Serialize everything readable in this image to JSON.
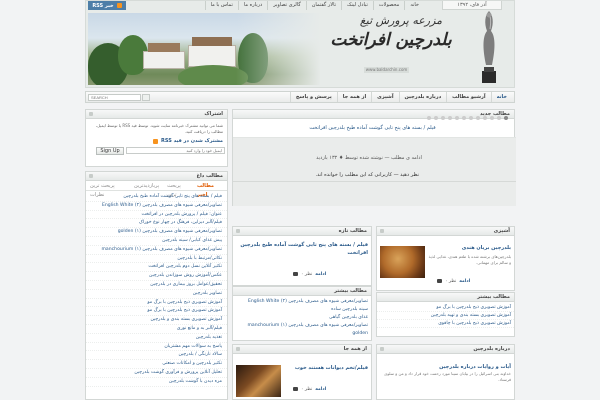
{
  "header": {
    "date": "آذر فای، ۱۳۹۲",
    "top_nav": [
      "خانه",
      "محصولات",
      "تبادل لینک",
      "تالار گفتمان",
      "گالری تصاویر",
      "درباره ما",
      "تماس با ما"
    ],
    "rss_label": "RSS خبر",
    "logo_subtitle": "مزرعه پرورش تیغ",
    "logo_title": "بلدرچین افراتخت",
    "logo_url": "www.baldarchin.com"
  },
  "main_nav": {
    "search_placeholder": "SEARCH",
    "items": [
      "خانه",
      "آرشیو مطالب",
      "درباره بلدرچین",
      "آشپزی",
      "از همه جا",
      "پرسش و پاسخ"
    ]
  },
  "announcement": {
    "heading": "اشتراک",
    "text": "شما می توانید مشترک خبرنامه سایت شوید. توسط فید RSS یا توسط ایمیل، مطالب را دریافت کنید.",
    "rss_subscribe": "مشترک شدن در فید RSS",
    "email_placeholder": "ایمیل خود را وارد کنید",
    "signup_label": "Sign Up"
  },
  "featured": {
    "heading": "مطالب جدید",
    "title": "فیلم / بسته های پنج تایی گوشت آماده طبخ بلدرچین افراتخت",
    "meta": "ادامه ی مطلب — نوشته شده توسط ♦ ۱۳۲ بازدید",
    "more": "نظر دهید — کاربرانی که این مطلب را خوانده اند."
  },
  "hot": {
    "heading": "مطالب داغ",
    "tabs": [
      "مطالب اخیر",
      "پربحث ترین",
      "پربازدیدترین",
      "پربحث ترین نظرات"
    ],
    "items": [
      "فیلم / بسته های پنج تایی گوشت آماده طبخ بلدرچین",
      "تصاویر/معرفی شیوه های مصرف بلدرچین (English White (۲",
      "عنوان: فیلم / پرورش بلدرچین در افراتخت",
      "فیلم/آلبر دیزاین، فرهنگ در چهار نوع خوراک",
      "تصاویر/معرفی شیوه های مصرف بلدرچین (golden (۱",
      "پیش غذای کبابی/ سینه بلدرچین",
      "تصاویر/معرفی شیوه های مصرف بلدرچین (manchourium (۱",
      "نکاتی/مرتبط با بلدرچین",
      "تکثیر آنلاین نسل دوم بلدرچین افراتخت",
      "عکس/آموزش روش سوزاندن بلدرچین",
      "تحقیق/عوامل بروز بیماری در بلدرچین",
      "تصاویر بلدرچین",
      "آموزش تصویری ذبح بلدرچین با برگ مو",
      "آموزش تصویری ذبح بلدرچین با برگ مو",
      "آموزش تصویری بسته بندی و بلدرچین",
      "فیلم/آلبر به و مانع نوری",
      "تغذیه بلدرچین",
      "پاسخ به سوالات مهم مشتریان",
      "سالاد نارنگی / بلدرچین",
      "تکثیر بلدرچین و امکانات صنعتی",
      "تحلیل آنلاین پرورش و فرآوری گوشت بلدرچین",
      "مزه دیدن با گوشت بلدرچین"
    ]
  },
  "new_posts": {
    "heading": "مطالب تازه",
    "title": "فیلم / بسته های پنج تایی گوشت آماده طبخ بلدرچین افراتخت",
    "more": "ادامه",
    "comment": "۰ نظر"
  },
  "latest": {
    "heading": "مطالب بیشتر",
    "items": [
      "تصاویر/معرفی شیوه های مصرف بلدرچین (English White (۲",
      "سینه بلدرچین ساده",
      "غذای بلدرچین گیاهی",
      "تصاویر/معرفی شیوه های مصرف بلدرچین (manchourium (۱",
      "golden"
    ]
  },
  "everywhere": {
    "heading": "از همه جا",
    "title": "فیلم/تخم دیوانات هستند خوب",
    "more": "ادامه",
    "comment": "۰ نظر"
  },
  "recipes": {
    "heading": "آشپزی",
    "title": "بلدرچین بریان هندی",
    "excerpt": "بلدرچین‌های برشته شده با طعم هندی، غذایی لذیذ و سالم برای مهمانی.",
    "more": "ادامه",
    "comment": "۰ نظر"
  },
  "most_viewed": {
    "heading": "مطالب بیشتر",
    "items": [
      "آموزش تصویری ذبح بلدرچین با برگ مو",
      "آموزش تصویری بسته بندی و تهیه بلدرچین",
      "آموزش تصویری ذبح بلدرچین با چاقوی"
    ]
  },
  "about": {
    "heading": "درباره بلدرچین",
    "title": "آیات و روایات درباره بلدرچین",
    "excerpt": "خداوند بنی اسرائیل را در بیابان سینا مورد رحمت خود قرار داد و من و سلوی فرستاد."
  }
}
